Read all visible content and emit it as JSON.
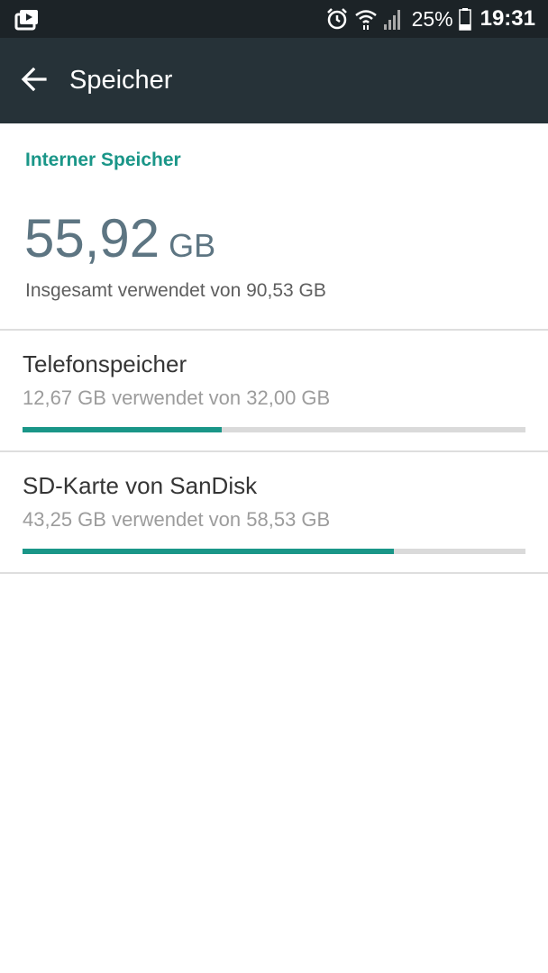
{
  "status_bar": {
    "battery_percent": "25%",
    "time": "19:31",
    "icons": [
      "video-notification-icon",
      "alarm-icon",
      "wifi-icon",
      "signal-icon",
      "battery-icon"
    ]
  },
  "app_bar": {
    "title": "Speicher",
    "back_icon": "arrow-back-icon"
  },
  "internal_storage": {
    "header": "Interner Speicher",
    "total_used": "55,92",
    "total_unit": "GB",
    "total_subtitle": "Insgesamt verwendet von 90,53 GB"
  },
  "storage_items": [
    {
      "title": "Telefonspeicher",
      "subtitle": "12,67 GB verwendet von 32,00 GB",
      "used_fraction": 0.3959
    },
    {
      "title": "SD-Karte von SanDisk",
      "subtitle": "43,25 GB verwendet von 58,53 GB",
      "used_fraction": 0.7389
    }
  ],
  "colors": {
    "accent": "#1a9688",
    "app_bar": "#263238",
    "status_bar": "#1c2327",
    "total_text": "#5d7582"
  }
}
